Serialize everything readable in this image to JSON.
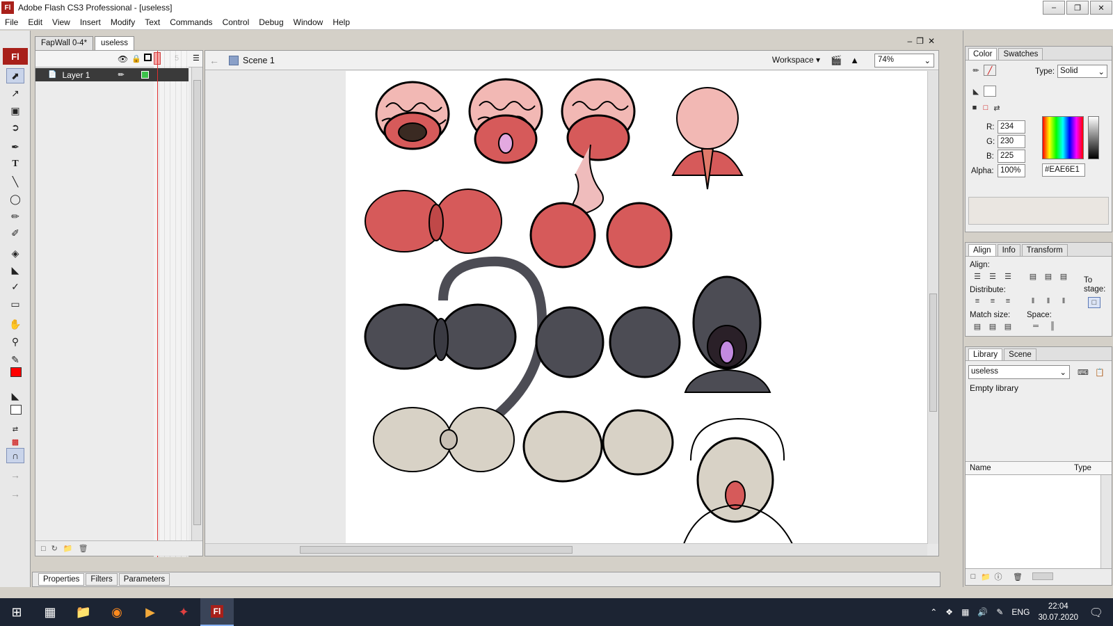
{
  "window": {
    "app_icon": "Fl",
    "title": "Adobe Flash CS3 Professional - [useless]",
    "buttons": [
      "minimize-icon",
      "restore-icon",
      "close-icon"
    ]
  },
  "menu": [
    "File",
    "Edit",
    "View",
    "Insert",
    "Modify",
    "Text",
    "Commands",
    "Control",
    "Debug",
    "Window",
    "Help"
  ],
  "tools_panel": {
    "logo": "Fl",
    "tools": [
      "selection-tool",
      "subselection-tool",
      "free-transform-tool",
      "lasso-tool",
      "pen-tool",
      "text-tool",
      "line-tool",
      "oval-tool",
      "pencil-tool",
      "brush-tool",
      "ink-bottle-tool",
      "paint-bucket-tool",
      "eyedropper-tool",
      "eraser-tool",
      "hand-tool",
      "zoom-tool"
    ],
    "stroke_color": "#000000",
    "fill_color": "#ff0000"
  },
  "documents": {
    "tabs": [
      "FapWall 0-4*",
      "useless"
    ],
    "active": "useless"
  },
  "timeline": {
    "frame_marker": "5",
    "layer_name": "Layer 1"
  },
  "editbar": {
    "scene": "Scene 1",
    "workspace": "Workspace",
    "zoom": "74%"
  },
  "properties_tabs": [
    "Properties",
    "Filters",
    "Parameters"
  ],
  "color_panel": {
    "tabs": [
      "Color",
      "Swatches"
    ],
    "type_label": "Type:",
    "type_value": "Solid",
    "r_label": "R:",
    "r": "234",
    "g_label": "G:",
    "g": "230",
    "b_label": "B:",
    "b": "225",
    "alpha_label": "Alpha:",
    "alpha": "100%",
    "hex": "#EAE6E1",
    "preview_color": "#eae6e1"
  },
  "align_panel": {
    "tabs": [
      "Align",
      "Info",
      "Transform"
    ],
    "align_label": "Align:",
    "distribute_label": "Distribute:",
    "match_size_label": "Match size:",
    "space_label": "Space:",
    "to_stage_label": "To stage:"
  },
  "library_panel": {
    "tabs": [
      "Library",
      "Scene"
    ],
    "document": "useless",
    "status": "Empty library",
    "col_name": "Name",
    "col_type": "Type"
  },
  "taskbar": {
    "language": "ENG",
    "time": "22:04",
    "date": "30.07.2020",
    "apps": [
      "windows-start-icon",
      "task-view-icon",
      "file-explorer-icon",
      "firefox-icon",
      "media-player-icon",
      "game-app-icon",
      "flash-app-icon"
    ]
  },
  "stage_colors": {
    "flesh_red": "#d65a5a",
    "brain_pink": "#f2b8b4",
    "dark_gray": "#4c4c54",
    "pale": "#d8d2c6"
  }
}
